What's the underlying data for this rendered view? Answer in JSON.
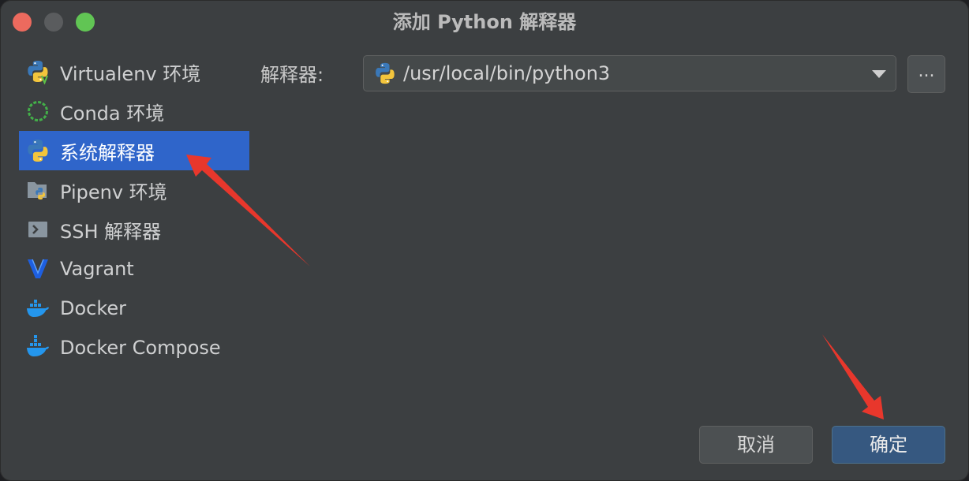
{
  "window": {
    "title": "添加 Python 解释器"
  },
  "sidebar": {
    "items": [
      {
        "label": "Virtualenv 环境",
        "icon": "virtualenv-icon"
      },
      {
        "label": "Conda 环境",
        "icon": "conda-icon"
      },
      {
        "label": "系统解释器",
        "icon": "python-icon",
        "selected": true
      },
      {
        "label": "Pipenv 环境",
        "icon": "pipenv-icon"
      },
      {
        "label": "SSH 解释器",
        "icon": "ssh-icon"
      },
      {
        "label": "Vagrant",
        "icon": "vagrant-icon"
      },
      {
        "label": "Docker",
        "icon": "docker-icon"
      },
      {
        "label": "Docker Compose",
        "icon": "docker-compose-icon"
      }
    ]
  },
  "main": {
    "interpreter_label": "解释器:",
    "interpreter_value": "/usr/local/bin/python3",
    "browse_label": "..."
  },
  "footer": {
    "cancel_label": "取消",
    "ok_label": "确定"
  },
  "colors": {
    "background": "#3c3f41",
    "selection": "#2f65ca",
    "primary_button": "#365880",
    "annotation_arrow": "#e8372c"
  }
}
